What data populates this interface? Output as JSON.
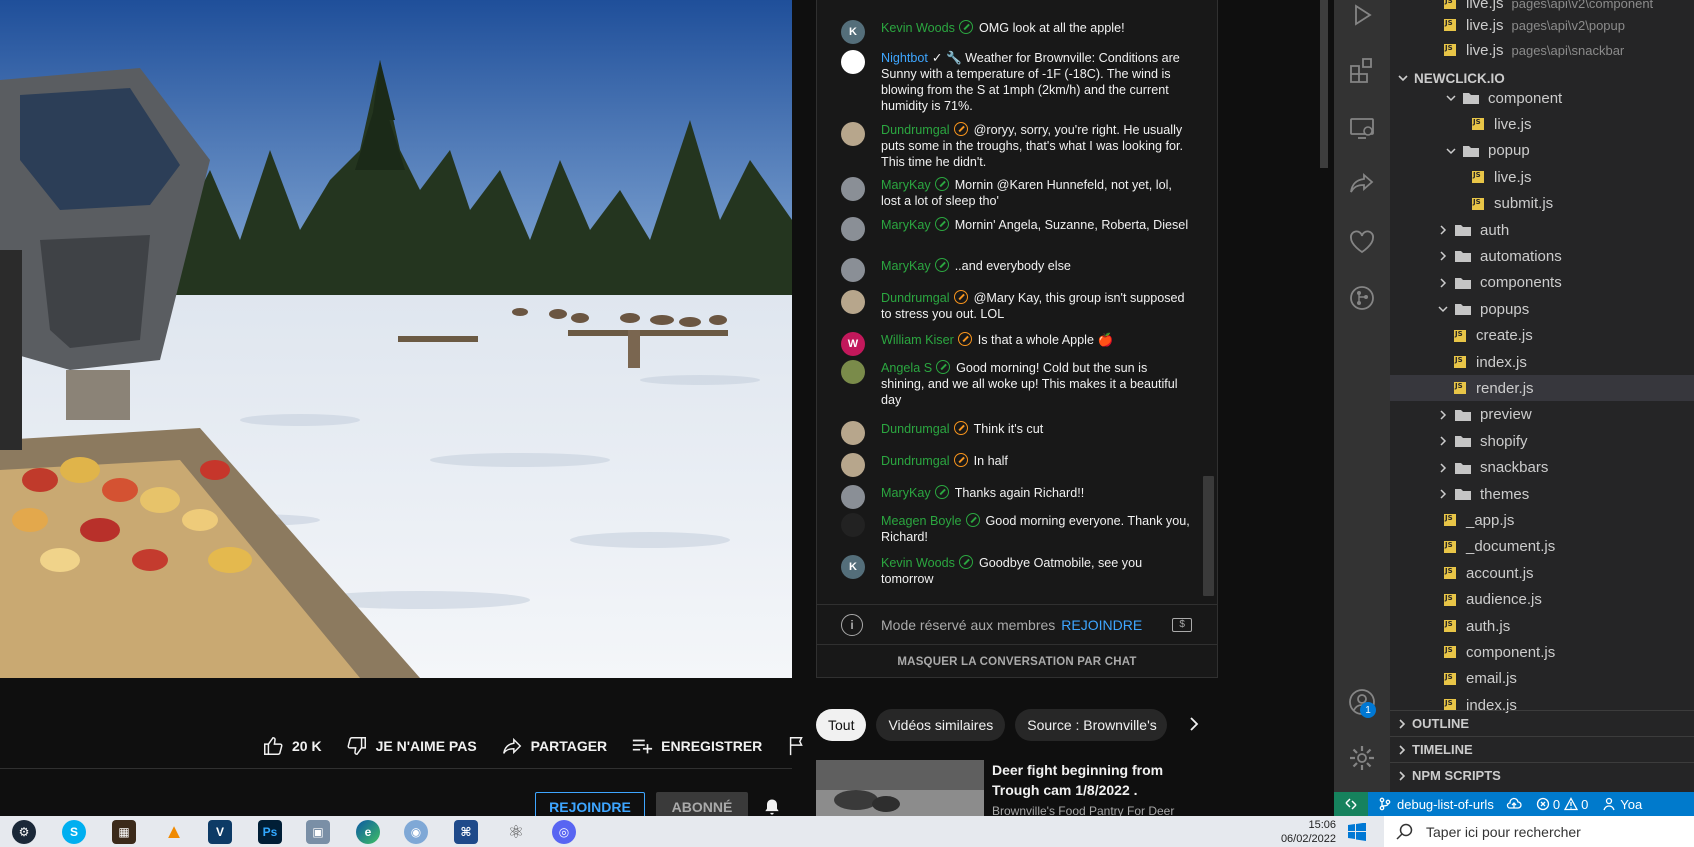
{
  "video": {
    "scene_alt": "Trough cam: open truck door, trough of apples, deer on snowy field"
  },
  "actions": {
    "likes": "20 K",
    "dislike": "JE N'AIME PAS",
    "share": "PARTAGER",
    "save": "ENREGISTRER"
  },
  "channel": {
    "join": "REJOINDRE",
    "subscribed": "ABONNÉ"
  },
  "chat": {
    "messages": [
      {
        "avatar": "K",
        "avatar_color": "#546e7a",
        "author": "Kevin Woods",
        "author_color": "green",
        "badge": "green",
        "text": "OMG look at all the apple!"
      },
      {
        "avatar": "",
        "avatar_color": "#ffffff",
        "author": "Nightbot",
        "author_color": "blue",
        "badge": "",
        "text": "✓ 🔧 Weather for Brownville: Conditions are Sunny with a temperature of -1F (-18C). The wind is blowing from the S at 1mph (2km/h) and the current humidity is 71%."
      },
      {
        "avatar": "",
        "avatar_color": "#b7a68c",
        "author": "Dundrumgal",
        "author_color": "green",
        "badge": "orange",
        "text": "@roryy, sorry, you're right. He usually puts some in the troughs, that's what I was looking for. This time he didn't."
      },
      {
        "avatar": "",
        "avatar_color": "#8a8f96",
        "author": "MaryKay",
        "author_color": "green",
        "badge": "green",
        "text": "Mornin @Karen Hunnefeld, not yet, lol, lost a lot of sleep tho'"
      },
      {
        "avatar": "",
        "avatar_color": "#8a8f96",
        "author": "MaryKay",
        "author_color": "green",
        "badge": "green",
        "text": "Mornin' Angela, Suzanne, Roberta, Diesel"
      },
      {
        "avatar": "",
        "avatar_color": "#8a8f96",
        "author": "MaryKay",
        "author_color": "green",
        "badge": "green",
        "text": "..and everybody else"
      },
      {
        "avatar": "",
        "avatar_color": "#b7a68c",
        "author": "Dundrumgal",
        "author_color": "green",
        "badge": "orange",
        "text": "@Mary Kay, this group isn't supposed to stress you out. LOL"
      },
      {
        "avatar": "W",
        "avatar_color": "#c2185b",
        "author": "William Kiser",
        "author_color": "green",
        "badge": "orange",
        "text": "Is that a whole Apple 🍎"
      },
      {
        "avatar": "",
        "avatar_color": "#7a8b4a",
        "author": "Angela S",
        "author_color": "green",
        "badge": "green",
        "text": "Good morning! Cold but the sun is shining, and we all woke up! This makes it a beautiful day"
      },
      {
        "avatar": "",
        "avatar_color": "#b7a68c",
        "author": "Dundrumgal",
        "author_color": "green",
        "badge": "orange",
        "text": "Think it's cut"
      },
      {
        "avatar": "",
        "avatar_color": "#b7a68c",
        "author": "Dundrumgal",
        "author_color": "green",
        "badge": "orange",
        "text": "In half"
      },
      {
        "avatar": "",
        "avatar_color": "#8a8f96",
        "author": "MaryKay",
        "author_color": "green",
        "badge": "green",
        "text": "Thanks again Richard!!"
      },
      {
        "avatar": "",
        "avatar_color": "#222222",
        "author": "Meagen Boyle",
        "author_color": "green",
        "badge": "green",
        "text": "Good morning everyone. Thank you, Richard!"
      },
      {
        "avatar": "K",
        "avatar_color": "#546e7a",
        "author": "Kevin Woods",
        "author_color": "green",
        "badge": "green",
        "text": "Goodbye Oatmobile, see you tomorrow"
      }
    ],
    "members_text": "Mode réservé aux membres",
    "members_join": "REJOINDRE",
    "hide": "MASQUER LA CONVERSATION PAR CHAT"
  },
  "chips": [
    "Tout",
    "Vidéos similaires",
    "Source : Brownville's"
  ],
  "recommendation": {
    "title": "Deer fight beginning from Trough cam 1/8/2022 .",
    "channel": "Brownville's Food Pantry For Deer"
  },
  "vscode": {
    "top_files": [
      {
        "name": "live.js",
        "path": "pages\\api\\v2\\component"
      },
      {
        "name": "live.js",
        "path": "pages\\api\\v2\\popup"
      },
      {
        "name": "live.js",
        "path": "pages\\api\\snackbar"
      }
    ],
    "project": "NEWCLICK.IO",
    "tree": [
      {
        "label": "component",
        "type": "folder-open"
      },
      {
        "label": "live.js",
        "type": "js"
      },
      {
        "label": "popup",
        "type": "folder-open"
      },
      {
        "label": "live.js",
        "type": "js"
      },
      {
        "label": "submit.js",
        "type": "js"
      },
      {
        "label": "auth",
        "type": "folder"
      },
      {
        "label": "automations",
        "type": "folder"
      },
      {
        "label": "components",
        "type": "folder"
      },
      {
        "label": "popups",
        "type": "folder-open"
      },
      {
        "label": "create.js",
        "type": "js"
      },
      {
        "label": "index.js",
        "type": "js"
      },
      {
        "label": "render.js",
        "type": "js"
      },
      {
        "label": "preview",
        "type": "folder"
      },
      {
        "label": "shopify",
        "type": "folder"
      },
      {
        "label": "snackbars",
        "type": "folder"
      },
      {
        "label": "themes",
        "type": "folder"
      },
      {
        "label": "_app.js",
        "type": "js"
      },
      {
        "label": "_document.js",
        "type": "js"
      },
      {
        "label": "account.js",
        "type": "js"
      },
      {
        "label": "audience.js",
        "type": "js"
      },
      {
        "label": "auth.js",
        "type": "js"
      },
      {
        "label": "component.js",
        "type": "js"
      },
      {
        "label": "email.js",
        "type": "js"
      },
      {
        "label": "index.js",
        "type": "js"
      }
    ],
    "sections": [
      "OUTLINE",
      "TIMELINE",
      "NPM SCRIPTS"
    ],
    "account_badge": "1",
    "status": {
      "branch": "debug-list-of-urls",
      "errors": "0",
      "warnings": "0",
      "user": "Yoa"
    }
  },
  "taskbar": {
    "time": "15:06",
    "date": "06/02/2022",
    "search_placeholder": "Taper ici pour rechercher"
  }
}
